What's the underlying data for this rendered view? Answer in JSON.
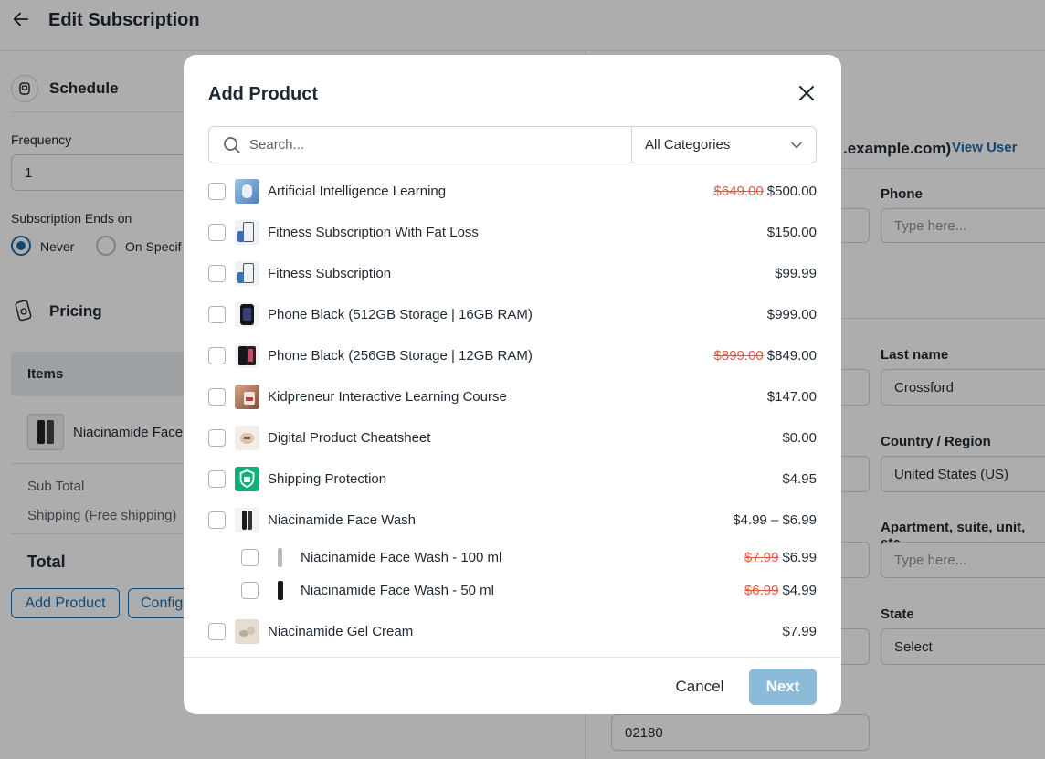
{
  "page": {
    "title": "Edit Subscription"
  },
  "schedule": {
    "heading": "Schedule",
    "frequency_label": "Frequency",
    "frequency_value": "1",
    "ends_label": "Subscription Ends on",
    "never_label": "Never",
    "on_specific_label": "On Specif"
  },
  "pricing": {
    "heading": "Pricing",
    "items_label": "Items",
    "item_name": "Niacinamide Face V",
    "subtotal_label": "Sub Total",
    "shipping_label": "Shipping (Free shipping)",
    "total_label": "Total",
    "add_product_label": "Add Product",
    "config_label": "Config"
  },
  "customer": {
    "email_partial": ".example.com)",
    "view_user_label": "View User",
    "phone_label": "Phone",
    "phone_placeholder": "Type here...",
    "last_name_label": "Last name",
    "last_name_value": "Crossford",
    "country_label": "Country / Region",
    "country_value": "United States (US)",
    "apartment_label": "Apartment, suite, unit, etc.",
    "apartment_placeholder": "Type here...",
    "state_label": "State",
    "state_value": "Select",
    "zip_value": "02180"
  },
  "modal": {
    "title": "Add Product",
    "search_placeholder": "Search...",
    "category_value": "All Categories",
    "cancel_label": "Cancel",
    "next_label": "Next",
    "products": [
      {
        "name": "Artificial Intelligence Learning",
        "old_price": "$649.00",
        "price": "$500.00"
      },
      {
        "name": "Fitness Subscription With Fat Loss",
        "old_price": "",
        "price": "$150.00"
      },
      {
        "name": "Fitness Subscription",
        "old_price": "",
        "price": "$99.99"
      },
      {
        "name": "Phone Black (512GB Storage | 16GB RAM)",
        "old_price": "",
        "price": "$999.00"
      },
      {
        "name": "Phone Black (256GB Storage | 12GB RAM)",
        "old_price": "$899.00",
        "price": "$849.00"
      },
      {
        "name": "Kidpreneur Interactive Learning Course",
        "old_price": "",
        "price": "$147.00"
      },
      {
        "name": "Digital Product Cheatsheet",
        "old_price": "",
        "price": "$0.00"
      },
      {
        "name": "Shipping Protection",
        "old_price": "",
        "price": "$4.95"
      },
      {
        "name": "Niacinamide Face Wash",
        "old_price": "",
        "price": "$4.99 – $6.99"
      },
      {
        "name": "Niacinamide Face Wash - 100 ml",
        "old_price": "$7.99",
        "price": "$6.99"
      },
      {
        "name": "Niacinamide Face Wash - 50 ml",
        "old_price": "$6.99",
        "price": "$4.99"
      },
      {
        "name": "Niacinamide Gel Cream",
        "old_price": "",
        "price": "$7.99"
      }
    ]
  },
  "colors": {
    "accent": "#1e6aa8",
    "sale": "#e25a44",
    "next_disabled": "#8bbbd9"
  }
}
